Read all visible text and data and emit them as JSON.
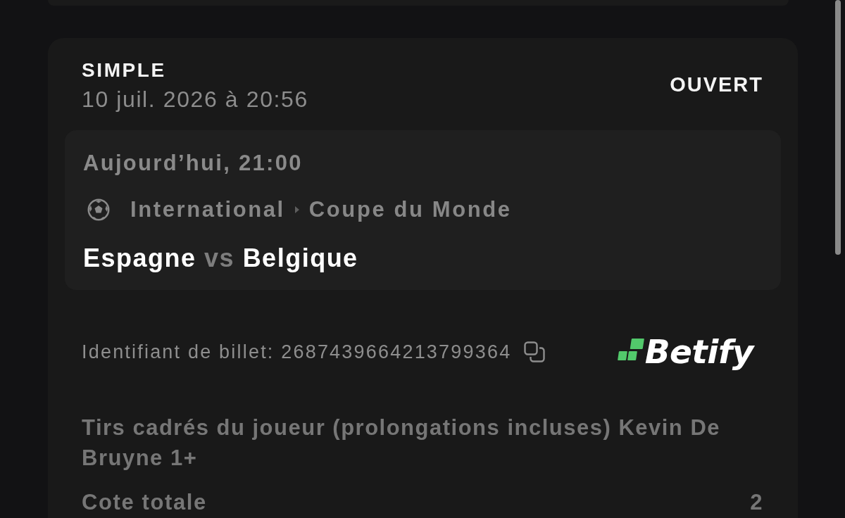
{
  "bet": {
    "type": "SIMPLE",
    "placed_at": "10 juil. 2026 à 20:56",
    "status": "OUVERT"
  },
  "event": {
    "time": "Aujourd’hui, 21:00",
    "breadcrumb": [
      "International",
      "Coupe du Monde"
    ],
    "home": "Espagne",
    "separator": "vs",
    "away": "Belgique"
  },
  "ticket": {
    "id_label": "Identifiant de billet: 2687439664213799364",
    "brand": "Betify"
  },
  "selection": "Tirs cadrés du joueur (prolongations incluses) Kevin De Bruyne 1+",
  "odds": {
    "label": "Cote totale",
    "value": "2"
  }
}
